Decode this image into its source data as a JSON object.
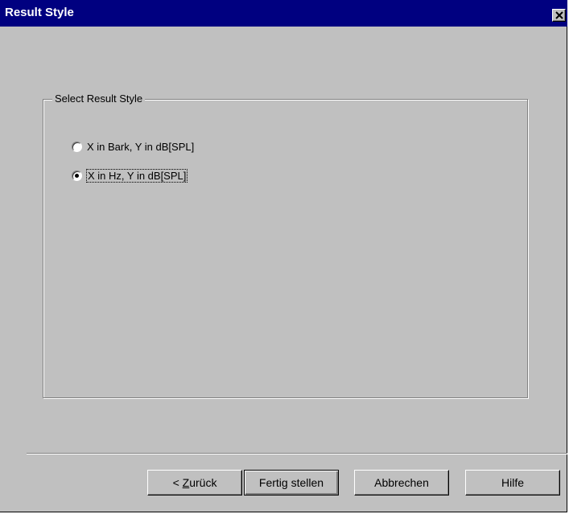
{
  "window": {
    "title": "Result Style"
  },
  "group": {
    "legend": "Select Result Style"
  },
  "options": [
    {
      "label": "X in Bark, Y in dB[SPL]",
      "selected": false
    },
    {
      "label": "X in Hz, Y in dB[SPL]",
      "selected": true
    }
  ],
  "buttons": {
    "back_prefix": "< ",
    "back_accel": "Z",
    "back_rest": "urück",
    "finish": "Fertig stellen",
    "cancel": "Abbrechen",
    "help": "Hilfe"
  }
}
